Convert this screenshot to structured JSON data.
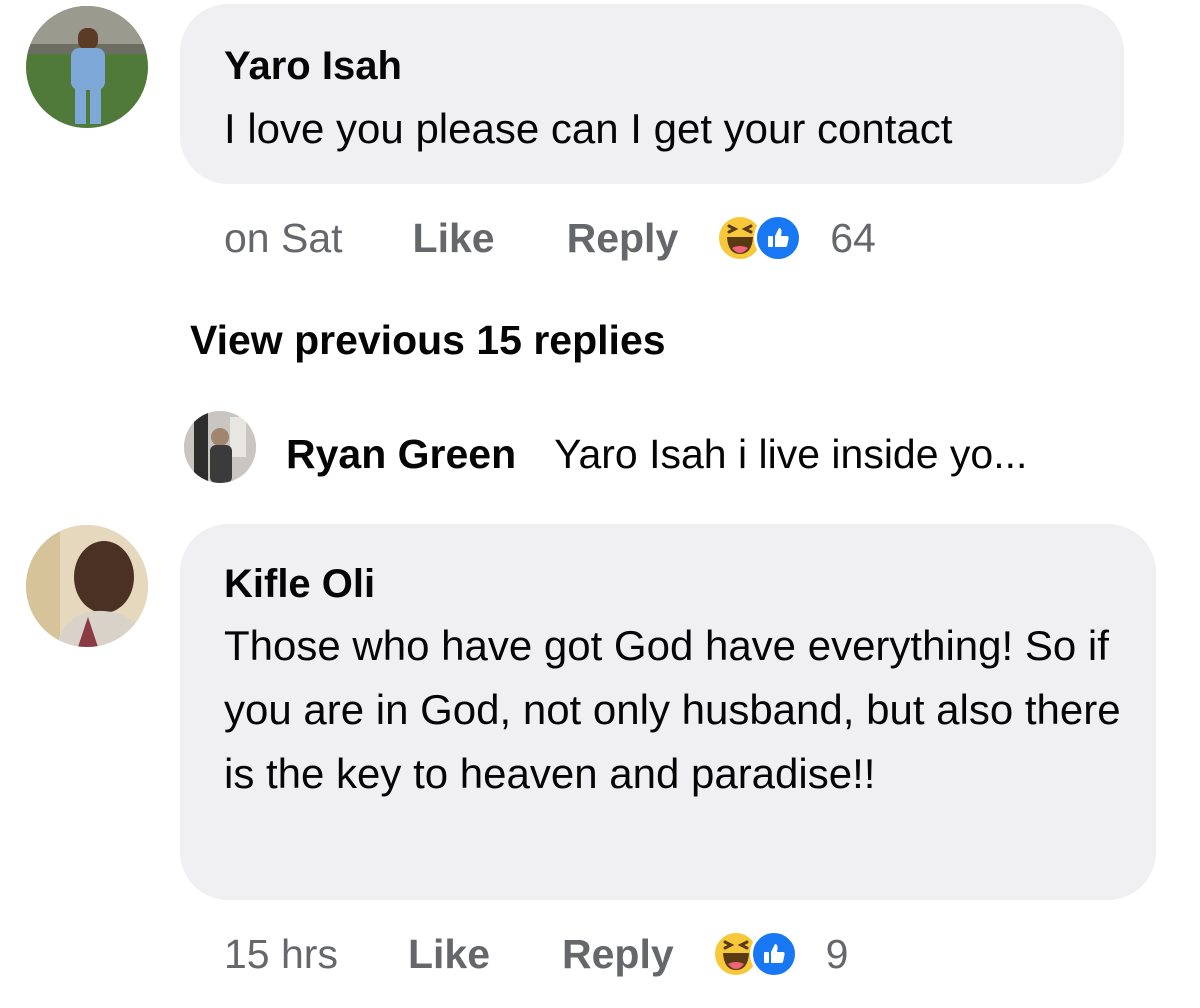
{
  "comments": [
    {
      "author": "Yaro Isah",
      "text": "I love you please can I get your contact",
      "time": "on Sat",
      "like_label": "Like",
      "reply_label": "Reply",
      "reactions": [
        "haha-icon",
        "like-icon"
      ],
      "reaction_count": "64"
    },
    {
      "author": "Kifle Oli",
      "text": "Those who have got God have everything! So if you are in God, not only husband, but also there is the key to heaven and paradise!!",
      "time": "15 hrs",
      "like_label": "Like",
      "reply_label": "Reply",
      "reactions": [
        "haha-icon",
        "like-icon"
      ],
      "reaction_count": "9"
    }
  ],
  "view_previous_label": "View previous 15 replies",
  "reply_preview": {
    "author": "Ryan Green",
    "text": "Yaro Isah i live inside yo..."
  },
  "colors": {
    "bubble": "#f0f0f3",
    "meta_text": "#65676b",
    "like_blue": "#1877f2",
    "haha_yellow": "#f7c83a"
  }
}
